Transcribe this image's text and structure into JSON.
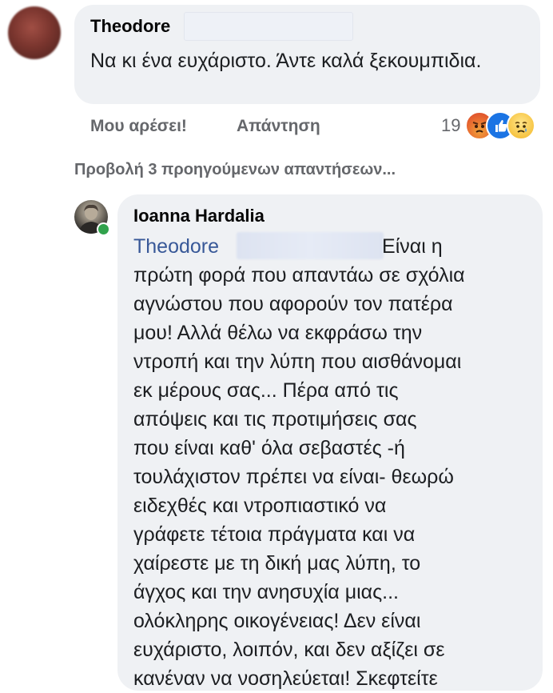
{
  "comment1": {
    "author": "Theodore",
    "text": "Να κι ένα ευχάριστο. Άντε καλά ξεκουμπιδια.",
    "actions": {
      "like": "Μου αρέσει!",
      "reply": "Απάντηση"
    },
    "reaction_count": "19",
    "reactions": [
      "angry-reaction-icon",
      "like-reaction-icon",
      "sad-reaction-icon"
    ]
  },
  "view_previous": "Προβολή 3 προηγούμενων απαντήσεων...",
  "comment2": {
    "author": "Ioanna Hardalia",
    "mention": "Theodore",
    "text_lines": [
      "Είναι η",
      "πρώτη φορά που απαντάω σε σχόλια",
      "αγνώστου που αφορούν τον πατέρα",
      "μου! Αλλά θέλω να εκφράσω την",
      "ντροπή και την λύπη που αισθάνομαι",
      "εκ μέρους σας... Πέρα από τις",
      "απόψεις και τις προτιμήσεις σας",
      "που είναι καθ' όλα σεβαστές -ή",
      "τουλάχιστον πρέπει να είναι- θεωρώ",
      "ειδεχθές και ντροπιαστικό να",
      "γράφετε τέτοια πράγματα και να",
      "χαίρεστε με τη δική μας λύπη, το",
      "άγχος και την ανησυχία μιας...",
      "ολόκληρης οικογένειας! Δεν είναι",
      "ευχάριστο, λοιπόν, και δεν αξίζει σε",
      "κανέναν να νοσηλεύεται! Σκεφτείτε"
    ]
  },
  "colors": {
    "bubble": "#eff1f4",
    "mention": "#385898",
    "secondary_text": "#65676b",
    "online": "#31a24c"
  }
}
